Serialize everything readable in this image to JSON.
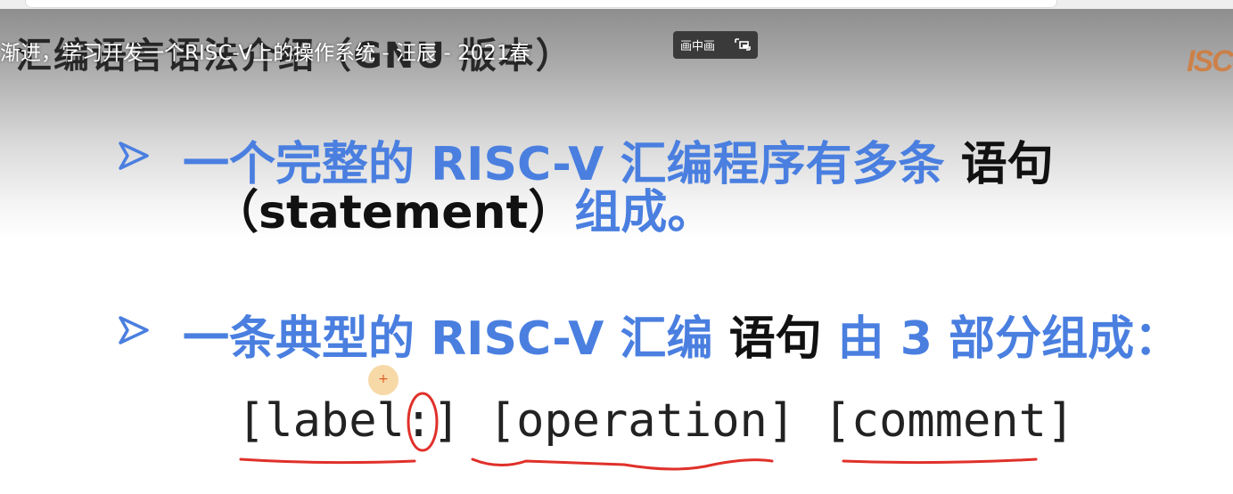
{
  "browser": {
    "address_bar": ""
  },
  "video": {
    "title": "渐进，学习开发一个RISC-V上的操作系统 - 汪辰 - 2021春",
    "pip_label": "画中画"
  },
  "slide": {
    "heading": "汇编语言语法介绍（GNU 版本）",
    "logo_text": "ISC-",
    "bullets": [
      {
        "line1_blue": "一个完整的 RISC-V 汇编程序有多条 ",
        "line1_black": "语句",
        "line2_black": "（statement）",
        "line2_blue": "组成。"
      },
      {
        "part1_blue": "一条典型的 RISC-V 汇编 ",
        "part2_black": "语句",
        "part3_blue": " 由 3 部分组成："
      }
    ],
    "syntax": {
      "label": "[label:]",
      "operation": "[operation]",
      "comment": "[comment]"
    },
    "cursor_marker": "+"
  },
  "colors": {
    "accent_blue": "#4a7fe0",
    "annotation_red": "#e0302a",
    "text_black": "#111111"
  }
}
